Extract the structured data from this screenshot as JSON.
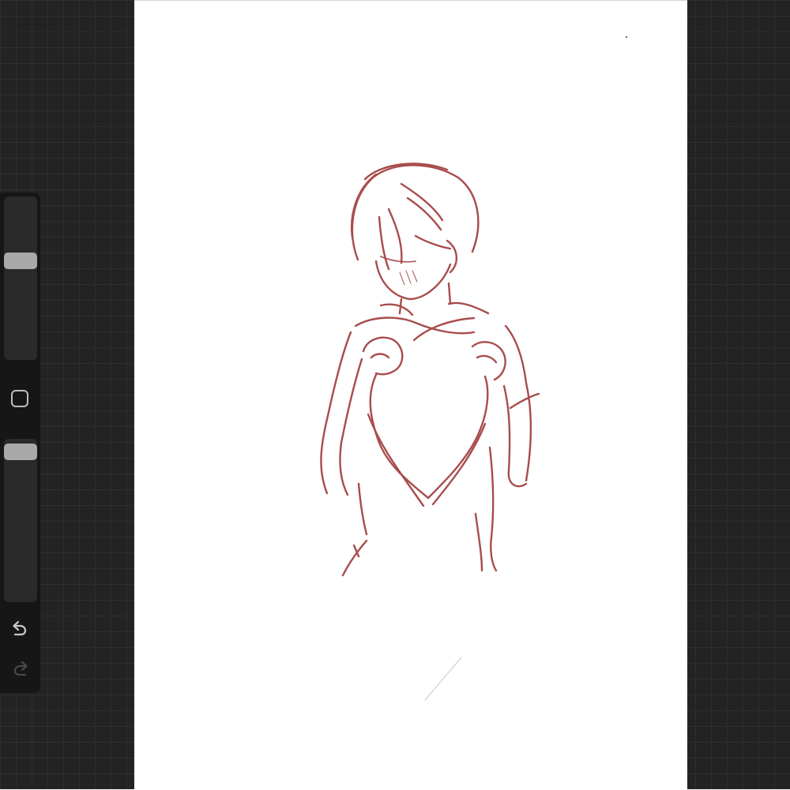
{
  "app": {
    "theme_colors": {
      "workspace_background": "#232323",
      "sidebar_background": "#161616",
      "slider_thumb": "#a9a9a9",
      "sketch_stroke": "#a84c4c",
      "canvas": "#ffffff"
    }
  },
  "sidebar": {
    "brush_size_slider": {
      "icon": "slider-thumb",
      "level": 0.62
    },
    "modify_button": {
      "icon": "square-outline-icon"
    },
    "brush_opacity_slider": {
      "icon": "slider-thumb",
      "level": 0.97
    },
    "undo": {
      "icon": "undo-arrow-icon",
      "enabled": true
    },
    "redo": {
      "icon": "redo-arrow-icon",
      "enabled": false
    }
  },
  "canvas": {
    "content": "sketch-drawing"
  }
}
